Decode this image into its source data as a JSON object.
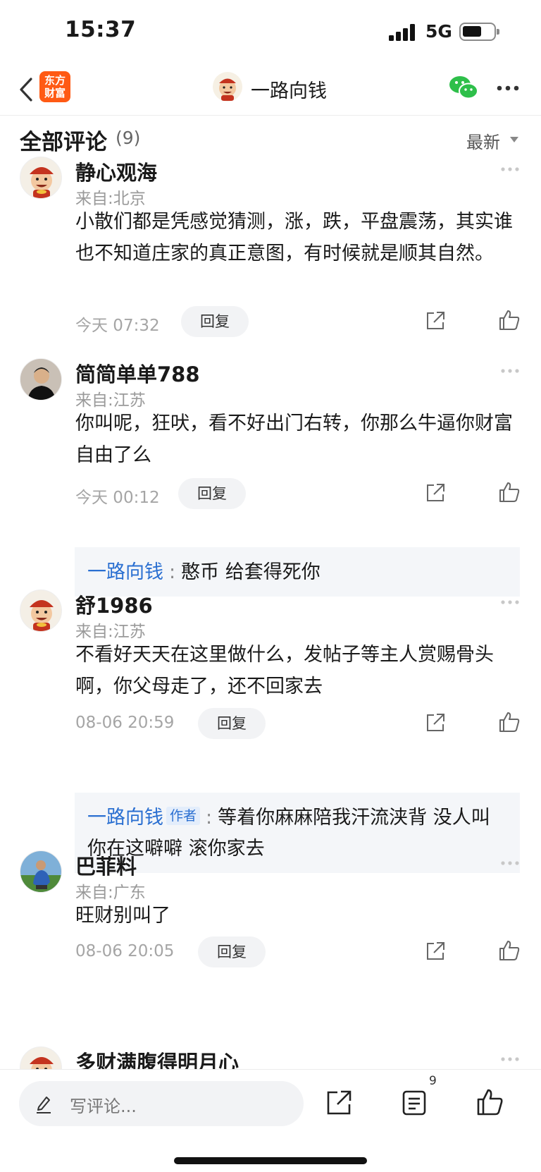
{
  "status_bar": {
    "time": "15:37",
    "network": "5G",
    "battery_level": 0.5
  },
  "nav": {
    "app_logo_text": "东方财富",
    "title": "一路向钱",
    "icons": [
      "chevron-left-icon",
      "wechat-icon",
      "more-icon"
    ]
  },
  "section": {
    "title": "全部评论",
    "count": "(9)",
    "sort_label": "最新"
  },
  "comments": [
    {
      "name": "静心观海",
      "location": "来自:北京",
      "body": "小散们都是凭感觉猜测，涨，跌，平盘震荡，其实谁也不知道庄家的真正意图，有时候就是顺其自然。",
      "time": "今天 07:32",
      "reply_label": "回复",
      "avatar": "cartoon-avatar"
    },
    {
      "name": "简简单单788",
      "location": "来自:江苏",
      "body": "你叫呢，狂吠，看不好出门右转，你那么牛逼你财富自由了么",
      "time": "今天 00:12",
      "reply_label": "回复",
      "avatar": "photo-avatar",
      "replies": [
        {
          "user": "一路向钱",
          "text": "憨币 给套得死你"
        }
      ]
    },
    {
      "name": "舒1986",
      "location": "来自:江苏",
      "body": "不看好天天在这里做什么，发帖子等主人赏赐骨头啊，你父母走了，还不回家去",
      "time": "08-06 20:59",
      "reply_label": "回复",
      "avatar": "cartoon-avatar",
      "replies": [
        {
          "user": "一路向钱",
          "tag": "作者",
          "text": "等着你麻麻陪我汗流浃背  没人叫你在这噼噼  滚你家去"
        }
      ]
    },
    {
      "name": "巴菲料",
      "location": "来自:广东",
      "body": "旺财别叫了",
      "time": "08-06 20:05",
      "reply_label": "回复",
      "avatar": "photo-avatar"
    },
    {
      "name": "多财满腹得明月心",
      "avatar": "cartoon-avatar"
    }
  ],
  "bottom_bar": {
    "placeholder": "写评论...",
    "comment_count": "9"
  }
}
